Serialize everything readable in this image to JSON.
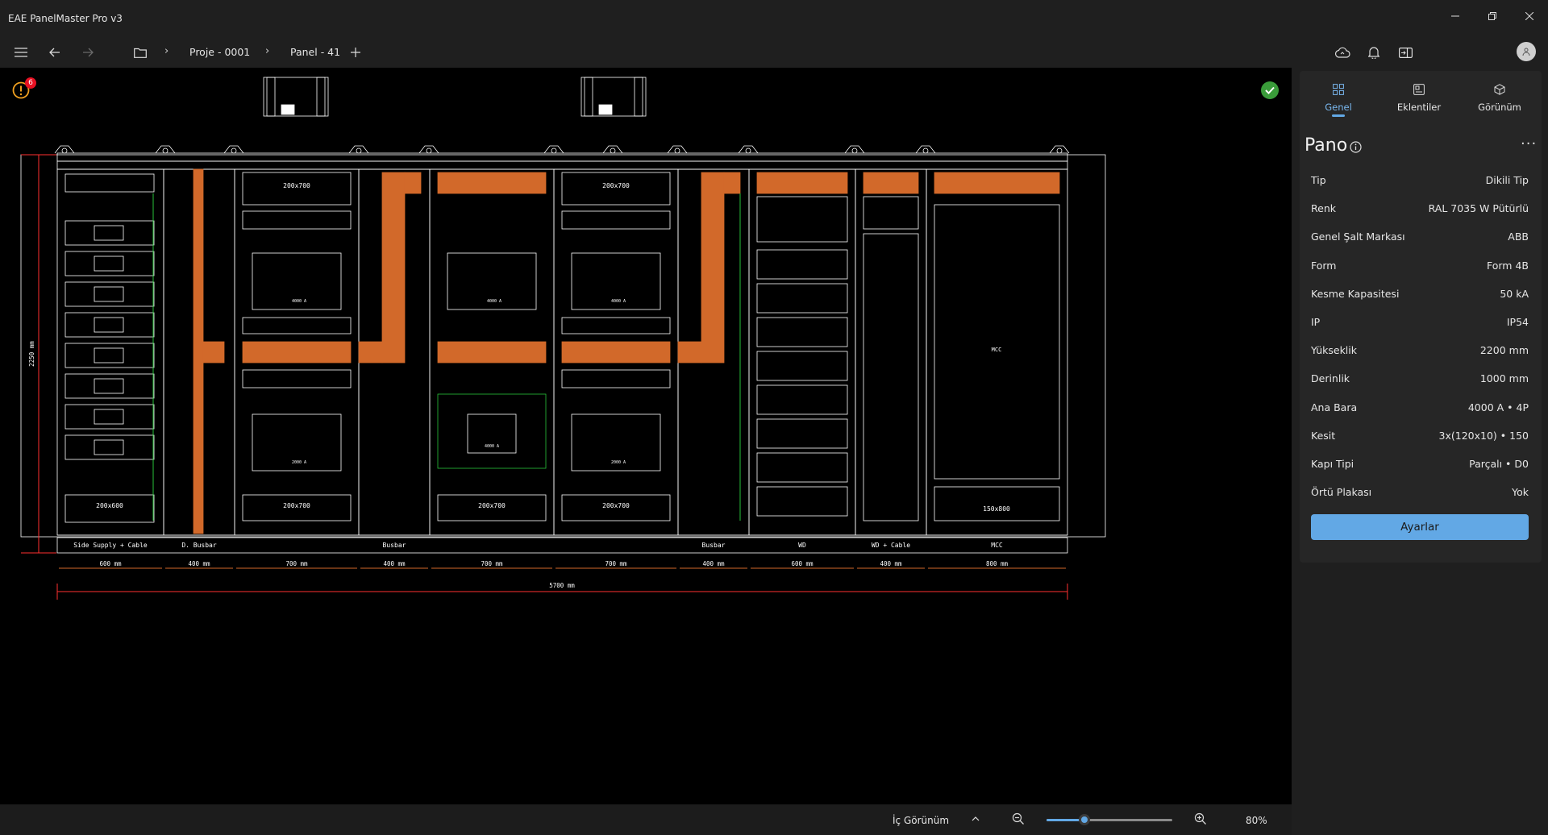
{
  "app": {
    "title": "EAE PanelMaster Pro v3"
  },
  "toolbar": {
    "breadcrumbs": [
      "Proje - 0001",
      "Panel - 41"
    ]
  },
  "canvas": {
    "warning_count": "6",
    "cabinet": {
      "height_label": "2250 mm",
      "total_label": "5700 mm",
      "sections": [
        {
          "label": "Side Supply + Cable",
          "width": "600 mm",
          "units": [
            "200x600"
          ]
        },
        {
          "label": "D. Busbar",
          "width": "400 mm"
        },
        {
          "label": "",
          "width": "700 mm",
          "units": [
            "200x700",
            "4000 A",
            "2000 A",
            "200x700"
          ]
        },
        {
          "label": "Busbar",
          "width": "400 mm"
        },
        {
          "label": "",
          "width": "700 mm",
          "units": [
            "4000 A",
            "4000 A",
            "200x700"
          ]
        },
        {
          "label": "",
          "width": "700 mm",
          "units": [
            "200x700",
            "4000 A",
            "2000 A",
            "200x700"
          ]
        },
        {
          "label": "Busbar",
          "width": "400 mm"
        },
        {
          "label": "WD",
          "width": "600 mm"
        },
        {
          "label": "WD + Cable",
          "width": "400 mm"
        },
        {
          "label": "MCC",
          "width": "800 mm",
          "units": [
            "MCC",
            "150x800"
          ]
        }
      ]
    }
  },
  "statusbar": {
    "view_label": "İç Görünüm",
    "zoom_label": "80%",
    "zoom_value": 0.3
  },
  "panel": {
    "tabs": [
      "Genel",
      "Eklentiler",
      "Görünüm"
    ],
    "title": "Pano",
    "properties": [
      {
        "label": "Tip",
        "value": "Dikili Tip"
      },
      {
        "label": "Renk",
        "value": "RAL 7035 W Pütürlü"
      },
      {
        "label": "Genel Şalt Markası",
        "value": "ABB"
      },
      {
        "label": "Form",
        "value": "Form 4B"
      },
      {
        "label": "Kesme Kapasitesi",
        "value": "50 kA"
      },
      {
        "label": "IP",
        "value": "IP54"
      },
      {
        "label": "Yükseklik",
        "value": "2200 mm"
      },
      {
        "label": "Derinlik",
        "value": "1000 mm"
      },
      {
        "label": "Ana Bara",
        "value": "4000 A • 4P"
      },
      {
        "label": "Kesit",
        "value": "3x(120x10) • 150"
      },
      {
        "label": "Kapı Tipi",
        "value": "Parçalı • D0"
      },
      {
        "label": "Örtü Plakası",
        "value": "Yok"
      }
    ],
    "button_label": "Ayarlar"
  },
  "colors": {
    "accent": "#62a8e5",
    "busbar": "#d2692a",
    "dimension": "#ff3030",
    "ok": "#3a9c3a",
    "warning": "#f0a020"
  }
}
